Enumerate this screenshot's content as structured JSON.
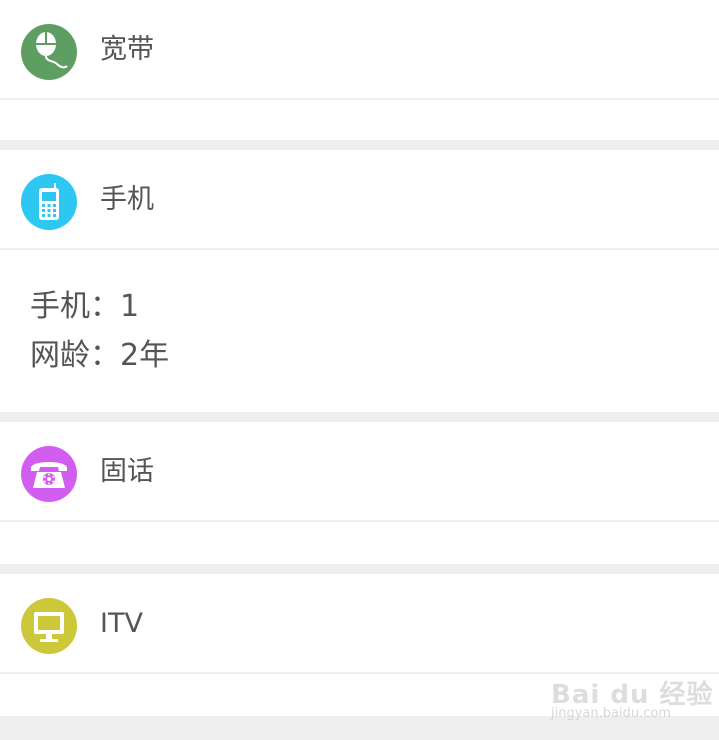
{
  "sections": [
    {
      "title": "宽带",
      "icon": "mouse-icon",
      "color": "#5f9e62"
    },
    {
      "title": "手机",
      "icon": "mobile-phone-icon",
      "color": "#2ec7f2"
    },
    {
      "title": "固话",
      "icon": "telephone-icon",
      "color": "#d25ef0"
    },
    {
      "title": "ITV",
      "icon": "tv-monitor-icon",
      "color": "#cdc83a"
    }
  ],
  "mobile_details": {
    "count_line": "手机：1",
    "age_line": "网龄：2年"
  },
  "watermark": {
    "main": "Bai du 经验",
    "sub": "jingyan.baidu.com"
  }
}
